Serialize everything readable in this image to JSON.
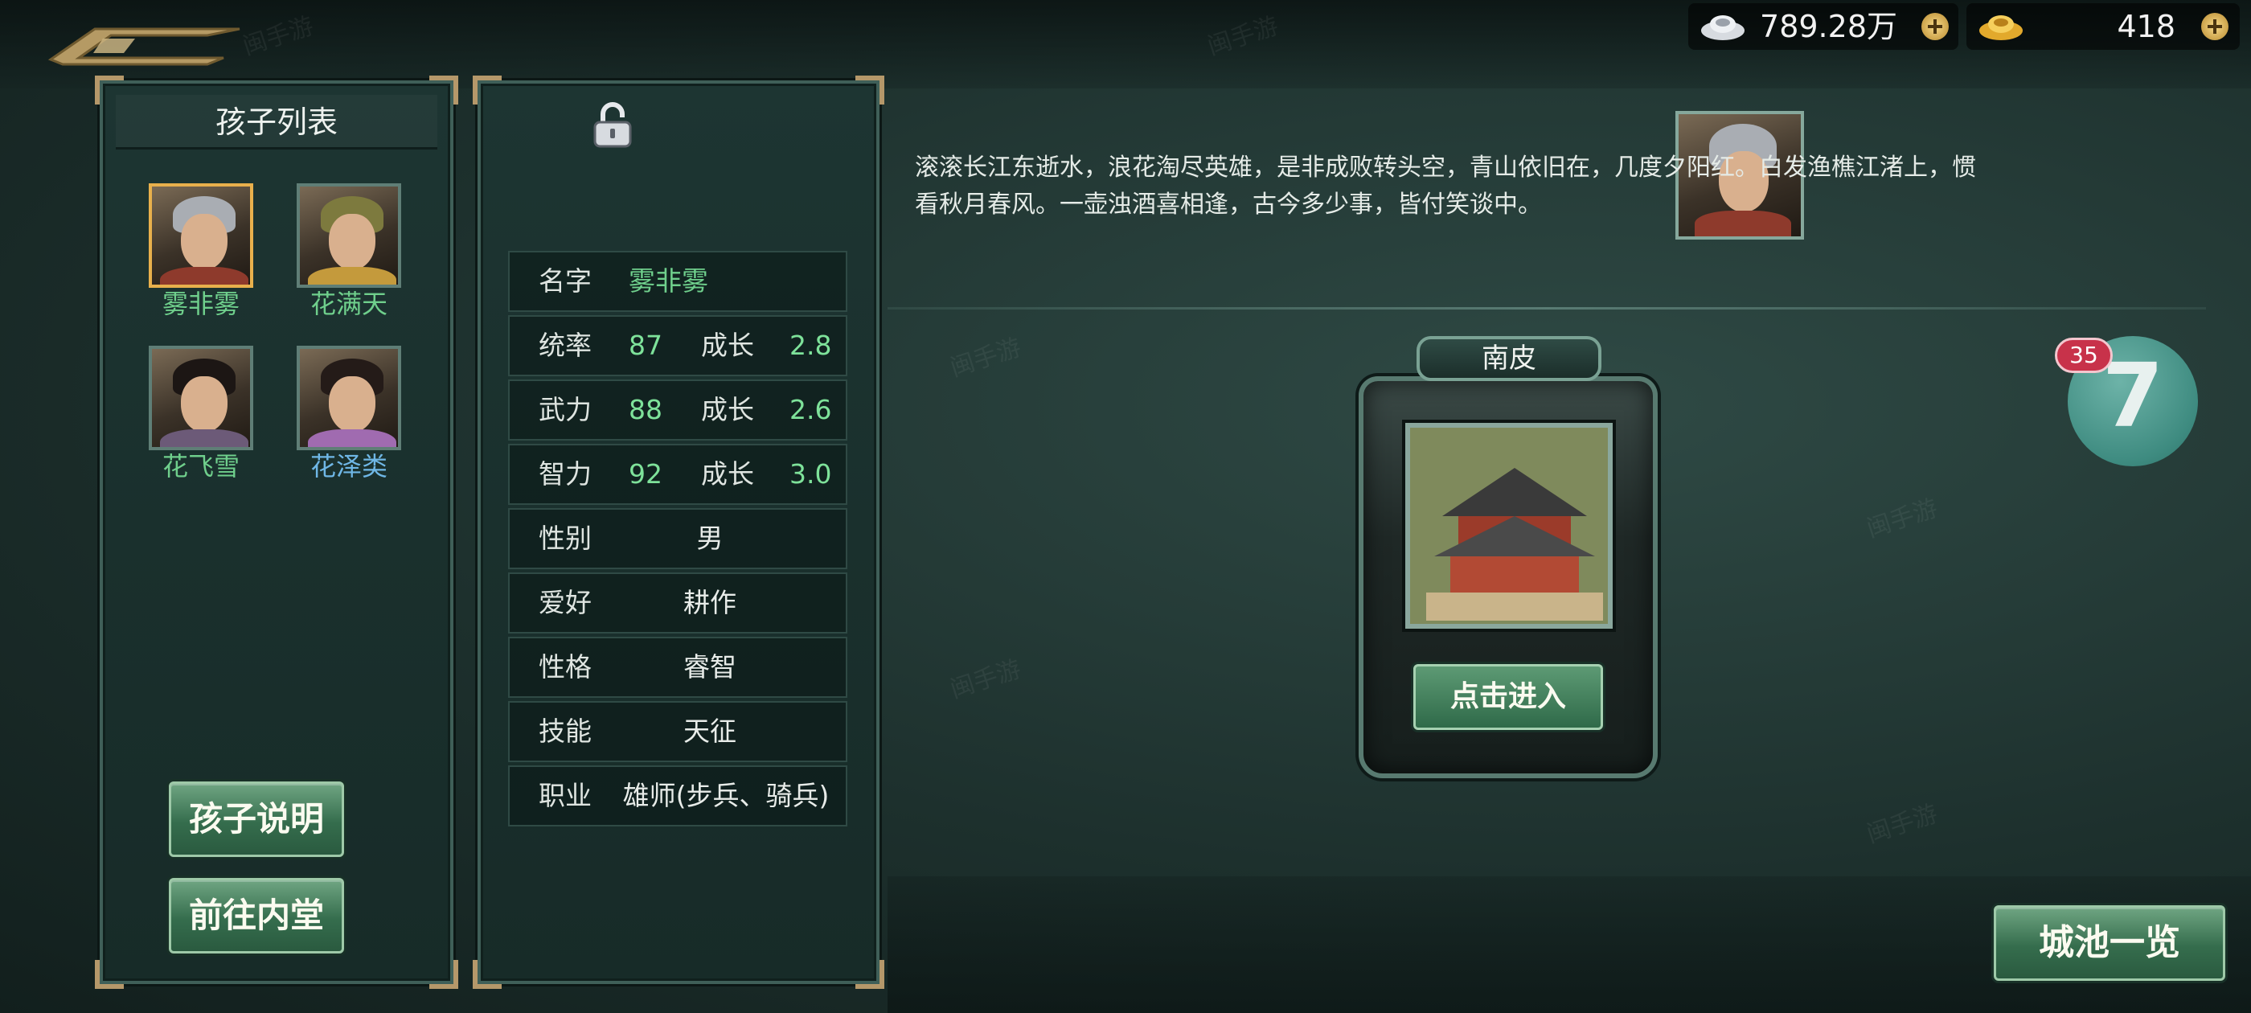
{
  "currency": {
    "silver": {
      "icon": "silver-ingot-icon",
      "value": "789.28万"
    },
    "gold": {
      "icon": "gold-ingot-icon",
      "value": "418"
    }
  },
  "child_list": {
    "title": "孩子列表",
    "children": [
      {
        "name": "雾非雾",
        "selected": true,
        "name_color": "#6fcf8c"
      },
      {
        "name": "花满天",
        "selected": false,
        "name_color": "#6fcf8c"
      },
      {
        "name": "花飞雪",
        "selected": false,
        "name_color": "#6fcf8c"
      },
      {
        "name": "花泽类",
        "selected": false,
        "name_color": "#6fb7e6"
      }
    ],
    "buttons": {
      "explain": "孩子说明",
      "inner_hall": "前往内堂"
    }
  },
  "child_info": {
    "name_label": "名字",
    "name": "雾非雾",
    "stats": [
      {
        "label": "统率",
        "value": "87",
        "growth_label": "成长",
        "growth": "2.8"
      },
      {
        "label": "武力",
        "value": "88",
        "growth_label": "成长",
        "growth": "2.6"
      },
      {
        "label": "智力",
        "value": "92",
        "growth_label": "成长",
        "growth": "3.0"
      }
    ],
    "rows": [
      {
        "label": "性别",
        "value": "男"
      },
      {
        "label": "爱好",
        "value": "耕作"
      },
      {
        "label": "性格",
        "value": "睿智"
      },
      {
        "label": "技能",
        "value": "天征"
      },
      {
        "label": "职业",
        "value": "雄师(步兵、骑兵)"
      }
    ]
  },
  "poem_line1": "滚滚长江东逝水，浪花淘尽英雄，是非成败转头空，青山依旧在，几度夕阳红。白发渔樵江渚上，惯",
  "poem_line2": "看秋月春风。一壶浊酒喜相逢，古今多少事，皆付笑谈中。",
  "city": {
    "name": "南皮",
    "enter_label": "点击进入"
  },
  "float_badge": {
    "count": "35",
    "digit": "7"
  },
  "city_list_label": "城池一览",
  "watermark_text": "闽手游"
}
